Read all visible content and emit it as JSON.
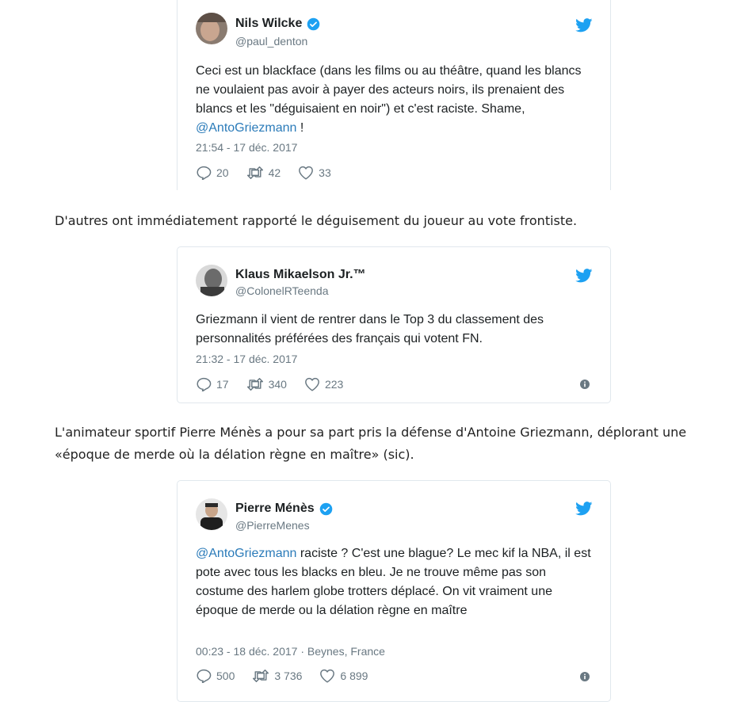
{
  "tweets": [
    {
      "name": "Nils Wilcke",
      "handle": "@paul_denton",
      "verified": true,
      "text_parts": [
        "Ceci est un blackface (dans les films ou au théâtre, quand les blancs ne voulaient pas avoir à payer des acteurs noirs, ils prenaient des blancs et les \"déguisaient en noir\") et c'est raciste. Shame, ",
        "@AntoGriezmann",
        " !"
      ],
      "timestamp": "21:54 - 17 déc. 2017",
      "replies": "20",
      "retweets": "42",
      "likes": "33"
    },
    {
      "name": "Klaus Mikaelson Jr.™",
      "handle": "@ColonelRTeenda",
      "verified": false,
      "text": "Griezmann il vient de rentrer dans le Top 3 du classement des personnalités préférées des français qui votent FN.",
      "timestamp": "21:32 - 17 déc. 2017",
      "replies": "17",
      "retweets": "340",
      "likes": "223"
    },
    {
      "name": "Pierre Ménès",
      "handle": "@PierreMenes",
      "verified": true,
      "text_parts": [
        "@AntoGriezmann",
        " raciste ? C'est une blague? Le mec kif la NBA, il est pote avec tous les blacks en bleu. Je ne trouve même pas son costume des harlem globe trotters déplacé. On vit vraiment une époque de merde ou la délation règne en maître"
      ],
      "timestamp": "00:23 - 18 déc. 2017 · Beynes, France",
      "replies": "500",
      "retweets": "3 736",
      "likes": "6 899"
    }
  ],
  "paragraphs": [
    "D'autres ont immédiatement rapporté le déguisement du joueur au vote frontiste.",
    "L'animateur sportif Pierre Ménès a pour sa part pris la défense d'Antoine Griezmann, déplorant une «époque de merde où la délation règne en maître» (sic)."
  ],
  "icons": {
    "twitter_bird": "twitter-bird-icon",
    "verified": "verified-badge-icon",
    "reply": "reply-icon",
    "retweet": "retweet-icon",
    "like": "heart-icon",
    "info": "info-icon"
  },
  "colors": {
    "twitter_blue": "#1da1f2",
    "mention": "#2b7bb9",
    "muted": "#697882",
    "border": "#e1e8ed"
  }
}
